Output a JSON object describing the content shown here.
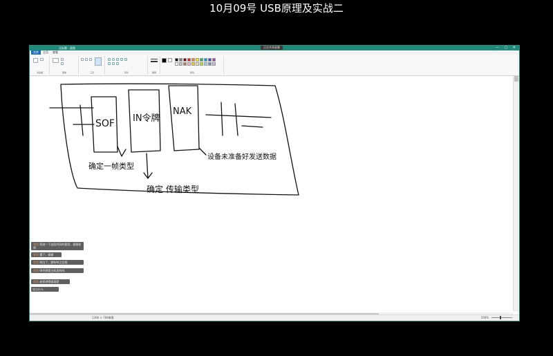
{
  "video": {
    "title": "10月09号 USB原理及实战二"
  },
  "window": {
    "app_title": "无标题 - 画图",
    "sharing_badge": "正在共享屏幕",
    "controls": "— ▢ ✕"
  },
  "tabs": [
    {
      "label": "文件"
    },
    {
      "label": "主页"
    },
    {
      "label": "查看"
    }
  ],
  "ribbon": {
    "groups": [
      {
        "label": "剪贴板"
      },
      {
        "label": "图像"
      },
      {
        "label": "工具"
      },
      {
        "label": "形状"
      },
      {
        "label": "粗细"
      },
      {
        "label": "颜色"
      }
    ],
    "colors": [
      "#000000",
      "#7f7f7f",
      "#880015",
      "#ed1c24",
      "#ff7f27",
      "#fff200",
      "#22b14c",
      "#00a2e8",
      "#3f48cc",
      "#a349a4",
      "#ffffff",
      "#c3c3c3",
      "#b97a57",
      "#ffaec9",
      "#ffc90e",
      "#efe4b0",
      "#b5e61d",
      "#99d9ea",
      "#7092be",
      "#c8bfe7"
    ]
  },
  "canvas_text": {
    "sof": "SOF",
    "in_token": "IN令牌",
    "nak": "NAK",
    "note_confirm_type": "确定一帧类型",
    "note_transfer": "确定 传输类型",
    "note_no_data": "设备未准备好发送数据"
  },
  "chat": {
    "messages": [
      {
        "who": "学员",
        "text": "再说一下这段代码的意思，谢谢老师"
      },
      {
        "who": "学员",
        "text": "懂了，谢谢"
      },
      {
        "who": "学员",
        "text": "明白了，那NAK之后呢"
      },
      {
        "who": "学员",
        "text": "IN令牌是主机发的吗"
      },
      {
        "who": "学员",
        "text": "老师讲得很清楚"
      }
    ],
    "input_placeholder": "说点什么"
  },
  "status": {
    "pixels": "1366 × 768像素",
    "zoom": "100%"
  }
}
